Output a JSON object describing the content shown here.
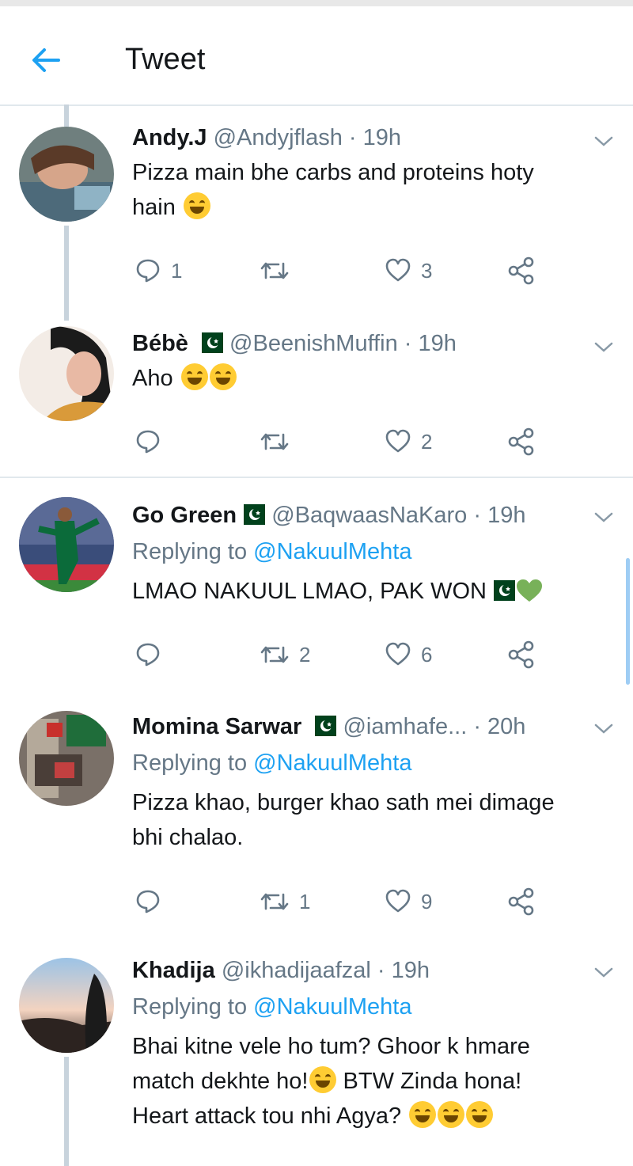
{
  "header": {
    "title": "Tweet"
  },
  "tweets": [
    {
      "name": "Andy.J",
      "handle": "@Andyjflash",
      "time": "19h",
      "text": "Pizza main bhe carbs and proteins hoty",
      "text2": "hain",
      "reply": "1",
      "retweet": "",
      "like": "3"
    },
    {
      "name": "Bébè",
      "handle": "@BeenishMuffin",
      "time": "19h",
      "text": "Aho",
      "reply": "",
      "retweet": "",
      "like": "2"
    },
    {
      "name": "Go Green",
      "handle": "@BaqwaasNaKaro",
      "time": "19h",
      "replying_label": "Replying to",
      "replying_to": "@NakuulMehta",
      "text": "LMAO NAKUUL LMAO, PAK WON",
      "reply": "",
      "retweet": "2",
      "like": "6"
    },
    {
      "name": "Momina Sarwar",
      "handle": "@iamhafe...",
      "time": "20h",
      "replying_label": "Replying to",
      "replying_to": "@NakuulMehta",
      "text": "Pizza khao, burger khao sath mei dimage",
      "text2": "bhi chalao.",
      "reply": "",
      "retweet": "1",
      "like": "9"
    },
    {
      "name": "Khadija",
      "handle": "@ikhadijaafzal",
      "time": "19h",
      "replying_label": "Replying to",
      "replying_to": "@NakuulMehta",
      "text": "Bhai kitne vele ho tum? Ghoor k hmare",
      "text2": "match dekhte ho!",
      "text2b": " BTW Zinda hona!",
      "text3": "Heart attack tou nhi Agya? "
    }
  ],
  "icons": {
    "back": "back-arrow-icon",
    "reply": "reply-bubble-icon",
    "retweet": "retweet-icon",
    "like": "heart-icon",
    "share": "share-icon",
    "more": "chevron-down-icon"
  },
  "colors": {
    "accent": "#1da1f2",
    "secondary_text": "#657786",
    "divider": "#e1e8ed"
  }
}
